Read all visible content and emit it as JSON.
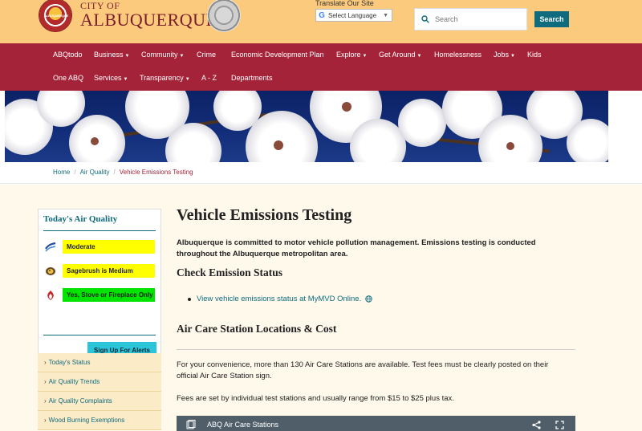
{
  "header": {
    "logo_seal_text": "ALBUQUERQUE",
    "city_of": "CITY OF",
    "city_name": "ALBUQUERQUE",
    "translate_label": "Translate Our Site",
    "language_select": "Select Language",
    "search_placeholder": "Search",
    "search_button": "Search"
  },
  "nav": {
    "row1": [
      {
        "label": "ABQtodo",
        "dropdown": false
      },
      {
        "label": "Business",
        "dropdown": true
      },
      {
        "label": "Community",
        "dropdown": true
      },
      {
        "label": "Crime",
        "dropdown": false
      },
      {
        "label": "Economic Development Plan",
        "dropdown": false
      },
      {
        "label": "Explore",
        "dropdown": true
      },
      {
        "label": "Get Around",
        "dropdown": true
      },
      {
        "label": "Homelessness",
        "dropdown": false
      },
      {
        "label": "Jobs",
        "dropdown": true
      },
      {
        "label": "Kids",
        "dropdown": false
      }
    ],
    "row2": [
      {
        "label": "One ABQ",
        "dropdown": false
      },
      {
        "label": "Services",
        "dropdown": true
      },
      {
        "label": "Transparency",
        "dropdown": true
      },
      {
        "label": "A - Z",
        "dropdown": false
      },
      {
        "label": "Departments",
        "dropdown": false
      }
    ]
  },
  "breadcrumb": {
    "items": [
      "Home",
      "Air Quality",
      "Vehicle Emissions Testing"
    ],
    "separator": "/"
  },
  "air_quality": {
    "title": "Today's Air Quality",
    "rows": [
      {
        "label": "Moderate",
        "color": "#ffff00",
        "icon": "wind-icon"
      },
      {
        "label": "Sagebrush is Medium",
        "color": "#ffff00",
        "icon": "pollen-icon"
      },
      {
        "label": "Yes, Stove or Fireplace Only",
        "color": "#00e400",
        "icon": "fire-icon"
      }
    ],
    "alert_button": "Sign Up For Alerts"
  },
  "side_menu": [
    "Today's Status",
    "Air Quality Trends",
    "Air Quality Complaints",
    "Wood Burning Exemptions"
  ],
  "content": {
    "title": "Vehicle Emissions Testing",
    "lead": "Albuquerque is committed to motor vehicle pollution management. Emissions testing is conducted throughout the Albuquerque metropolitan area.",
    "h2_status": "Check Emission Status",
    "status_link": "View vehicle emissions status at MyMVD Online.",
    "h2_locations": "Air Care Station Locations & Cost",
    "para1": "For your convenience, more than 130 Air Care Stations are available. Test fees must be clearly posted on their official Air Care Station sign.",
    "para2": "Fees are set by individual test stations and usually range from $15 to $25 plus tax.",
    "video_title": "ABQ Air Care Stations"
  },
  "colors": {
    "header_bg": "#fcca7c",
    "nav_bg": "#a52338",
    "accent": "#0f6b7e",
    "alert_button": "#2cc4d8",
    "main_bg": "#fff9ec"
  }
}
